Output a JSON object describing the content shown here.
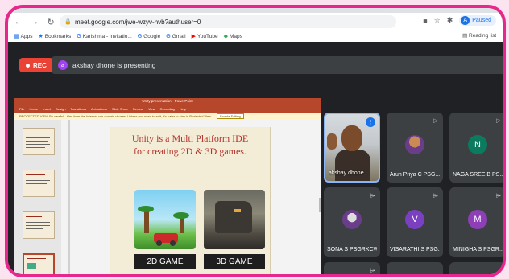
{
  "browser": {
    "url": "meet.google.com/jwe-wzyv-hvb?authuser=0",
    "profile_label": "Paused",
    "bookmarks": [
      {
        "icon": "apps-icon",
        "label": "Apps"
      },
      {
        "icon": "star-icon",
        "label": "Bookmarks"
      },
      {
        "icon": "google-icon",
        "label": "Karishma - Invitatio..."
      },
      {
        "icon": "google-icon",
        "label": "Google"
      },
      {
        "icon": "google-icon",
        "label": "Gmail"
      },
      {
        "icon": "youtube-icon",
        "label": "YouTube"
      },
      {
        "icon": "maps-icon",
        "label": "Maps"
      }
    ],
    "reading_list": "Reading list"
  },
  "meet": {
    "rec_label": "REC",
    "presenter_initial": "a",
    "presenting_text": "akshay dhone is presenting"
  },
  "slides_app": {
    "window_title": "Unity presentation - PowerPoint",
    "ribbon_tabs": [
      "File",
      "Home",
      "Insert",
      "Design",
      "Transitions",
      "Animations",
      "Slide Show",
      "Review",
      "View",
      "Recording",
      "Help"
    ],
    "warning_text": "PROTECTED VIEW  Be careful—files from the Internet can contain viruses. Unless you need to edit, it's safer to stay in Protected View.",
    "warning_button": "Enable Editing"
  },
  "slide": {
    "title_line1": "Unity is a Multi Platform IDE",
    "title_line2": "for creating 2D & 3D games.",
    "caption_2d": "2D GAME",
    "caption_3d": "3D GAME"
  },
  "participants": [
    {
      "name": "akshay dhone",
      "kind": "speaker",
      "color": "#1a73e8"
    },
    {
      "name": "Arun Priya C PSG...",
      "kind": "photo",
      "color": "#6a3d8a"
    },
    {
      "name": "NAGA SREE B PS...",
      "kind": "initial",
      "initial": "N",
      "color": "#0b7a5f"
    },
    {
      "name": "SONA S PSGRKCW",
      "kind": "photo",
      "color": "#6a3d8a"
    },
    {
      "name": "VISARATHI S PSG...",
      "kind": "initial",
      "initial": "V",
      "color": "#7b3fc2"
    },
    {
      "name": "MINIGHA S PSGR...",
      "kind": "initial",
      "initial": "M",
      "color": "#8e3fb8"
    }
  ]
}
